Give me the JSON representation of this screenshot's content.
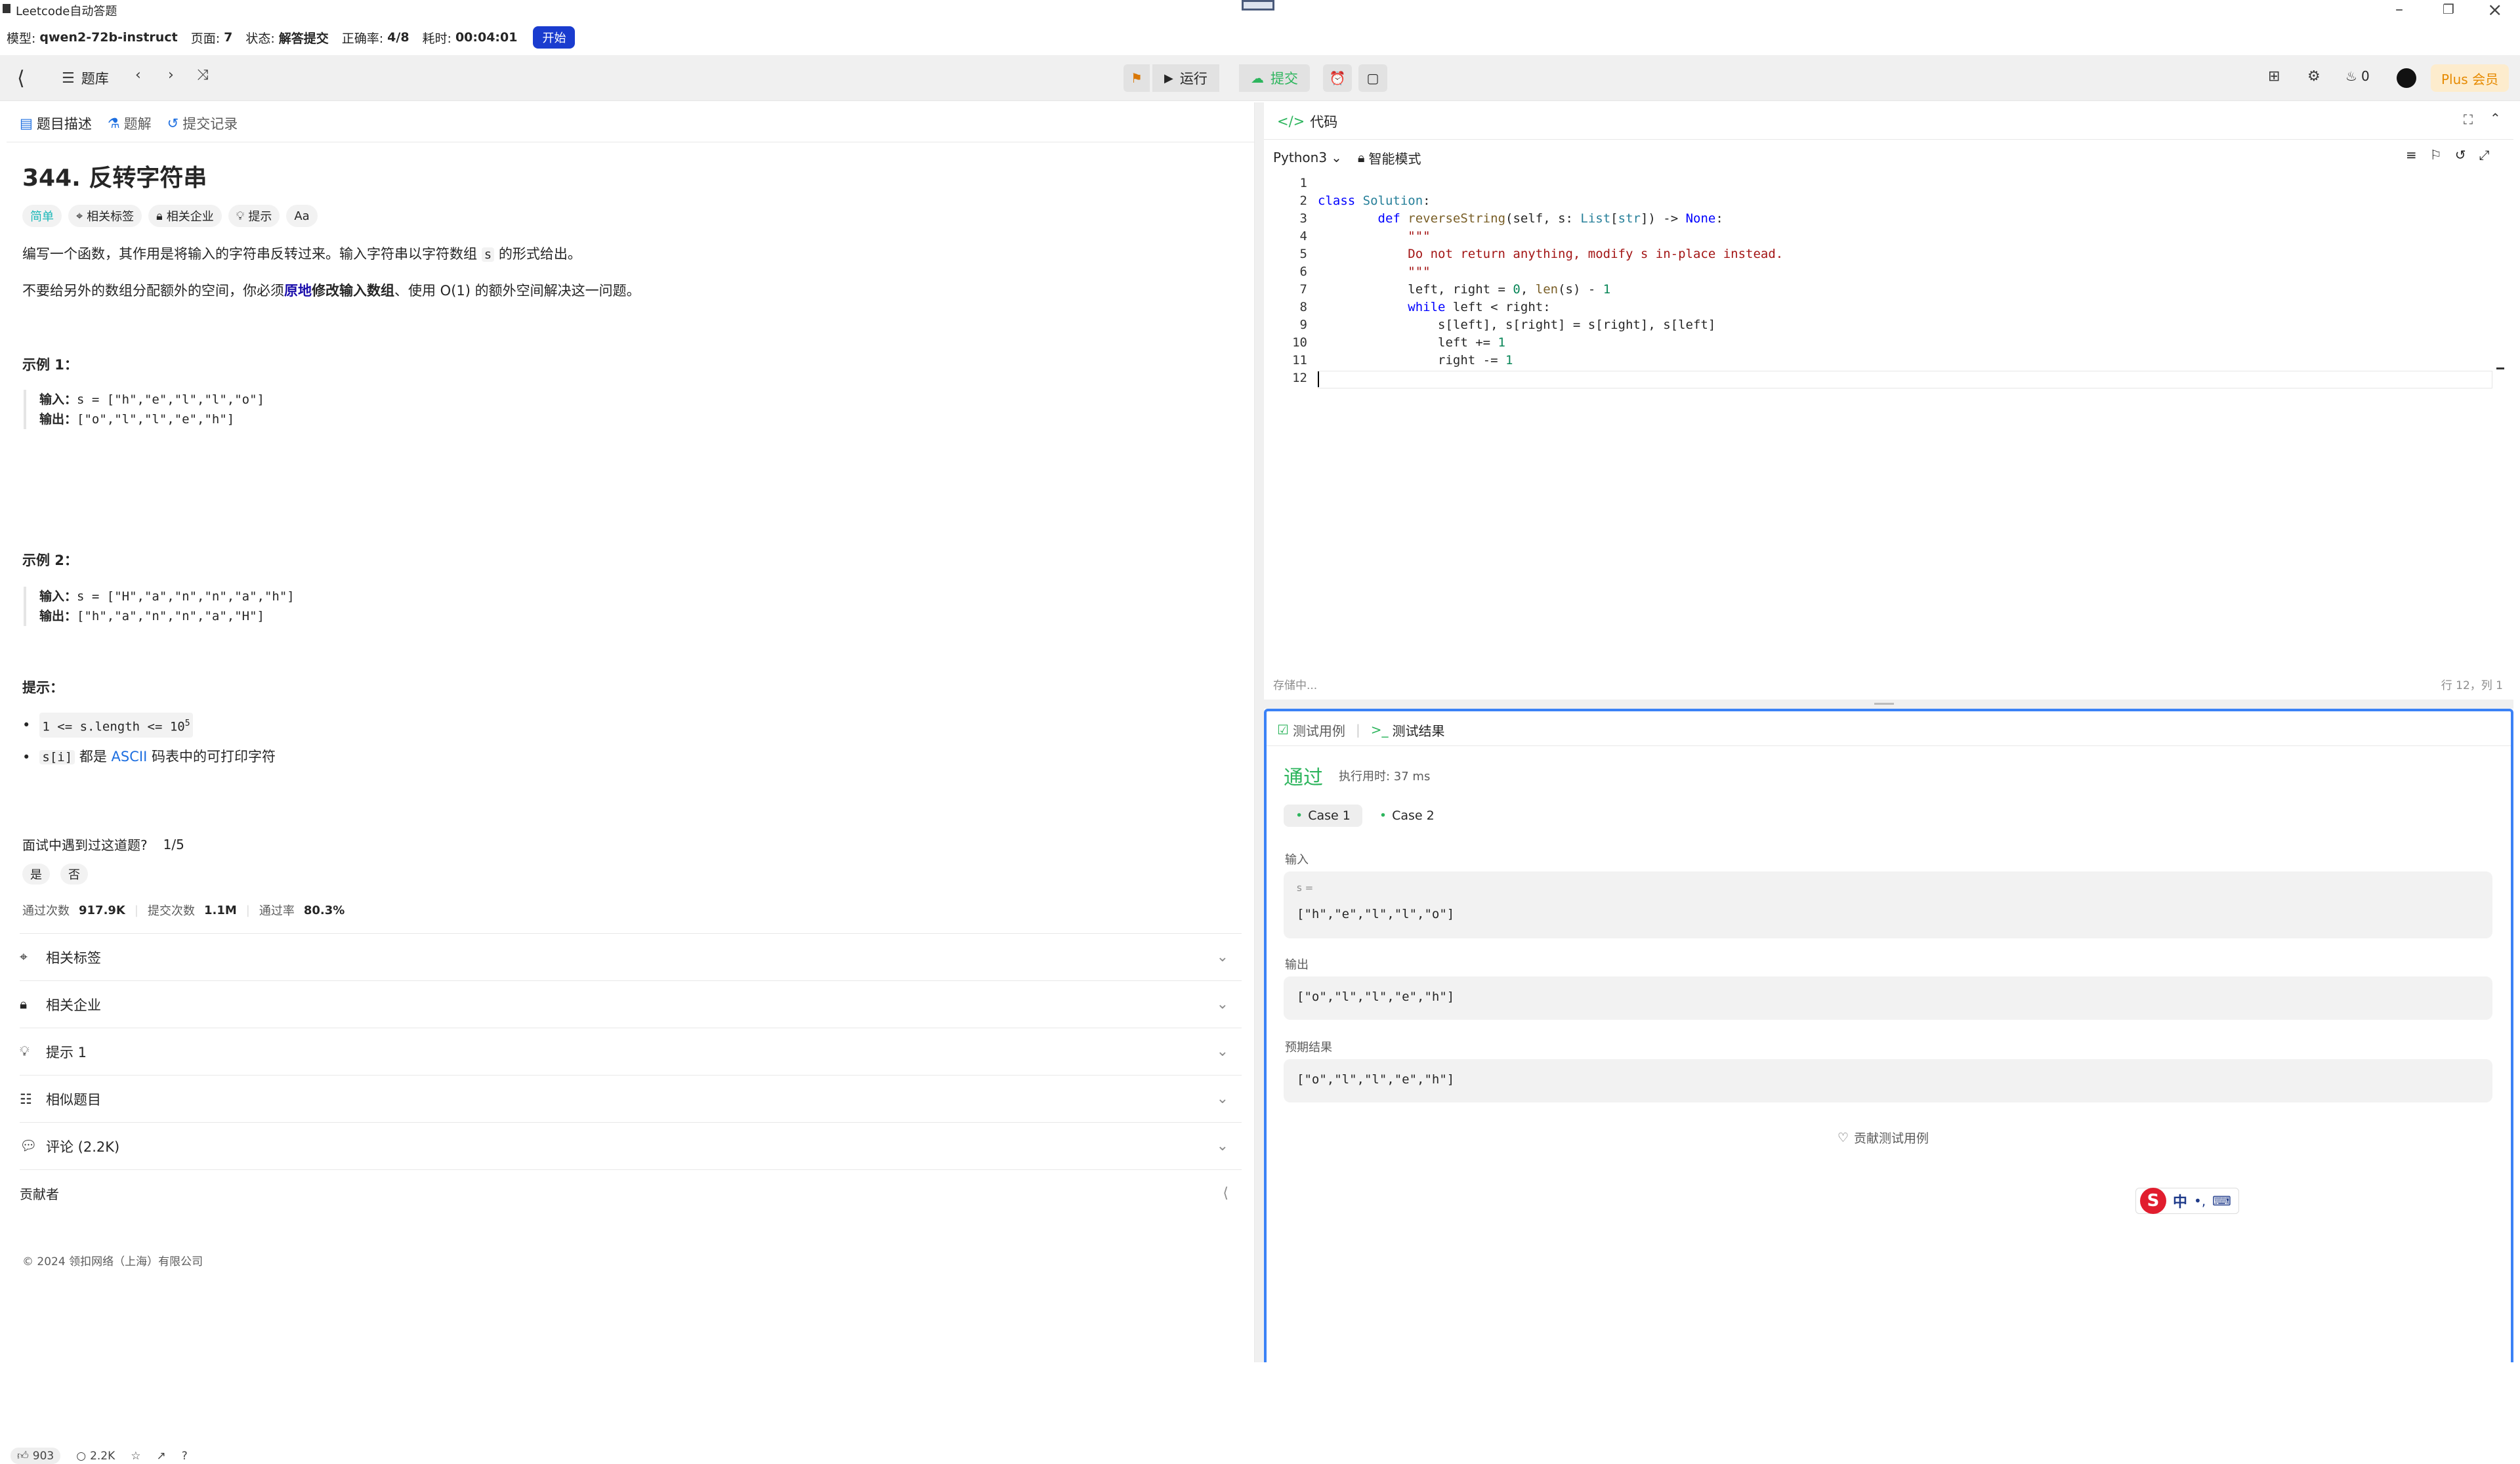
{
  "window": {
    "title": "Leetcode自动答题"
  },
  "status": {
    "model_label": "模型:",
    "model": "qwen2-72b-instruct",
    "page_label": "页面:",
    "page": "7",
    "state_label": "状态:",
    "state": "解答提交",
    "acc_label": "正确率:",
    "acc": "4/8",
    "time_label": "耗时:",
    "time": "00:04:01",
    "start": "开始"
  },
  "nav": {
    "problems": "题库",
    "run": "运行",
    "submit": "提交",
    "streak": "0",
    "plus": "Plus 会员"
  },
  "left": {
    "tabs": [
      "题目描述",
      "题解",
      "提交记录"
    ],
    "title": "344. 反转字符串",
    "tags": [
      "简单",
      "相关标签",
      "相关企业",
      "提示",
      "Aa"
    ],
    "desc1_a": "编写一个函数，其作用是将输入的字符串反转过来。输入字符串以字符数组 ",
    "desc1_code": "s",
    "desc1_b": " 的形式给出。",
    "desc2_a": "不要给另外的数组分配额外的空间，你必须",
    "desc2_link": "原地",
    "desc2_bold": "修改输入数组",
    "desc2_b": "、使用 O(1) 的额外空间解决这一问题。",
    "ex1_title": "示例 1：",
    "ex1_in_label": "输入：",
    "ex1_in": "s = [\"h\",\"e\",\"l\",\"l\",\"o\"]",
    "ex1_out_label": "输出：",
    "ex1_out": "[\"o\",\"l\",\"l\",\"e\",\"h\"]",
    "ex2_title": "示例 2：",
    "ex2_in_label": "输入：",
    "ex2_in": "s = [\"H\",\"a\",\"n\",\"n\",\"a\",\"h\"]",
    "ex2_out_label": "输出：",
    "ex2_out": "[\"h\",\"a\",\"n\",\"n\",\"a\",\"H\"]",
    "hints_title": "提示：",
    "hint1": "1 <= s.length <= 10",
    "hint1_sup": "5",
    "hint2_code": "s[i]",
    "hint2_a": " 都是 ",
    "hint2_link": "ASCII",
    "hint2_b": " 码表中的可打印字符",
    "interview_q": "面试中遇到过这道题?",
    "interview_frac": "1/5",
    "yes": "是",
    "no": "否",
    "stats": {
      "acc_label": "通过次数",
      "acc": "917.9K",
      "sub_label": "提交次数",
      "sub": "1.1M",
      "rate_label": "通过率",
      "rate": "80.3%"
    },
    "acc_items": [
      "相关标签",
      "相关企业",
      "提示 1",
      "相似题目",
      "评论 (2.2K)"
    ],
    "contrib": "贡献者",
    "copyright": "© 2024 领扣网络（上海）有限公司",
    "bottom": {
      "likes": "903",
      "comments": "2.2K"
    }
  },
  "code": {
    "header": "代码",
    "lang": "Python3",
    "mode": "智能模式",
    "saving": "存储中...",
    "pos": "行 12，列 1",
    "lines": [
      "",
      "class Solution:",
      "    def reverseString(self, s: List[str]) -> None:",
      "        \"\"\"",
      "        Do not return anything, modify s in-place instead.",
      "        \"\"\"",
      "        left, right = 0, len(s) - 1",
      "        while left < right:",
      "            s[left], s[right] = s[right], s[left]",
      "            left += 1",
      "            right -= 1",
      ""
    ]
  },
  "test": {
    "tab1": "测试用例",
    "tab2": "测试结果",
    "result": "通过",
    "runtime": "执行用时: 37 ms",
    "cases": [
      "Case 1",
      "Case 2"
    ],
    "input_label": "输入",
    "var": "s =",
    "input": "[\"h\",\"e\",\"l\",\"l\",\"o\"]",
    "output_label": "输出",
    "output": "[\"o\",\"l\",\"l\",\"e\",\"h\"]",
    "expected_label": "预期结果",
    "expected": "[\"o\",\"l\",\"l\",\"e\",\"h\"]",
    "contribute": "贡献测试用例"
  },
  "ime": {
    "lang": "中"
  }
}
